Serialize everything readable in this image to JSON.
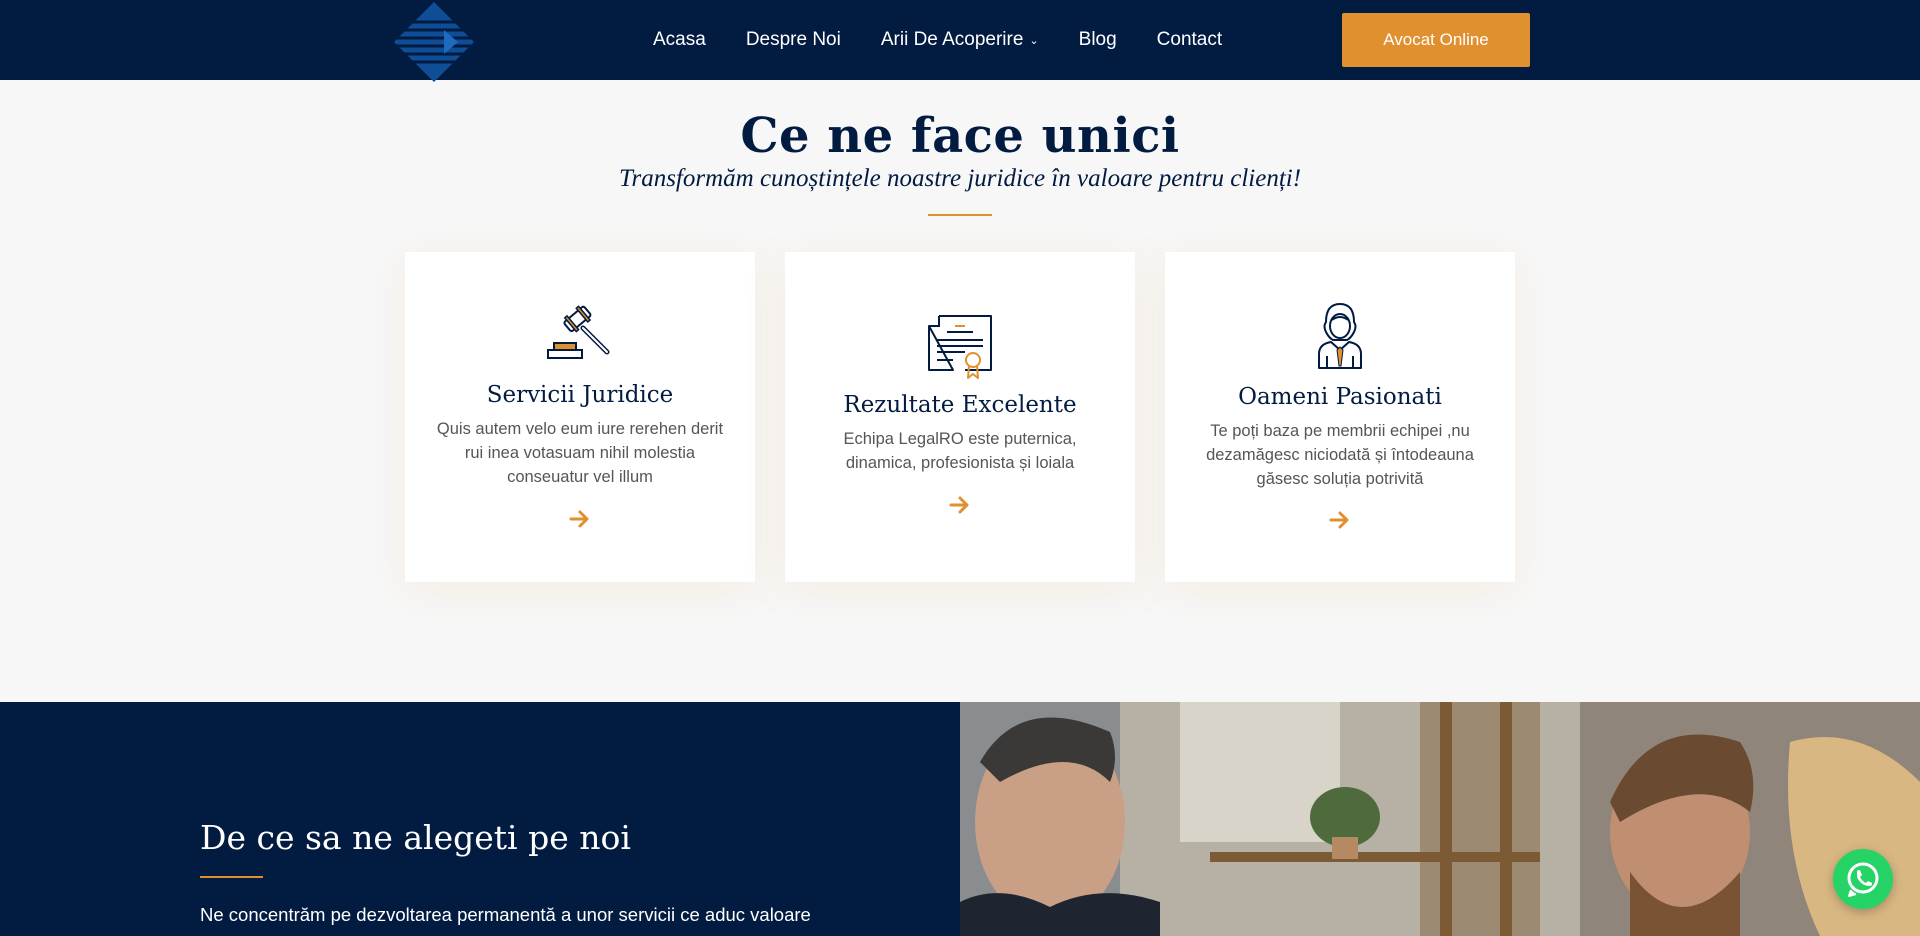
{
  "header": {
    "nav": [
      {
        "label": "Acasa"
      },
      {
        "label": "Despre Noi"
      },
      {
        "label": "Arii De Acoperire"
      },
      {
        "label": "Blog"
      },
      {
        "label": "Contact"
      }
    ],
    "cta_label": "Avocat Online"
  },
  "features": {
    "title": "Ce ne face unici",
    "subtitle": "Transformăm cunoștințele noastre juridice în valoare pentru clienți!",
    "cards": [
      {
        "icon": "gavel-icon",
        "title": "Servicii Juridice",
        "text": "Quis autem velo eum iure rerehen derit rui inea votasuam nihil molestia conseuatur vel illum"
      },
      {
        "icon": "certificate-icon",
        "title": "Rezultate Excelente",
        "text": "Echipa LegalRO este puternica, dinamica, profesionista și loiala"
      },
      {
        "icon": "lawyer-icon",
        "title": "Oameni Pasionati",
        "text": "Te poți baza pe membrii echipei ,nu dezamăgesc niciodată și întodeauna găsesc soluția potrivită"
      }
    ]
  },
  "why": {
    "title": "De ce sa ne alegeti pe noi",
    "text": "Ne concentrăm pe dezvoltarea permanentă a unor servicii ce aduc valoare"
  },
  "colors": {
    "navy": "#021b41",
    "accent": "#e0902e",
    "whatsapp": "#25d366"
  }
}
